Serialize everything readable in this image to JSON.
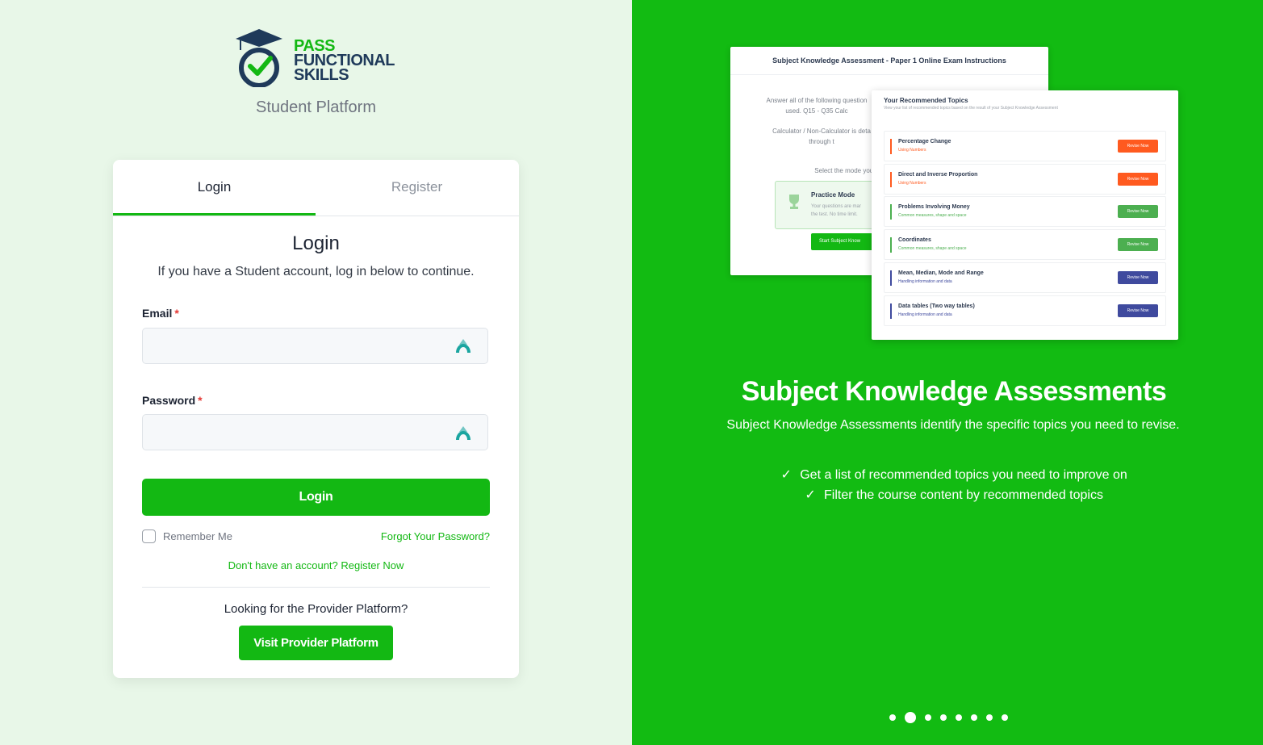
{
  "brand": {
    "logo_line1": "PASS",
    "logo_line2": "FUNCTIONAL",
    "logo_line3": "SKILLS",
    "platform": "Student Platform",
    "green": "#13b813",
    "navy": "#1f3a5a"
  },
  "tabs": [
    {
      "label": "Login",
      "active": true
    },
    {
      "label": "Register",
      "active": false
    }
  ],
  "login": {
    "title": "Login",
    "description": "If you have a Student account, log in below to continue.",
    "email_label": "Email",
    "email_value": "",
    "password_label": "Password",
    "password_value": "",
    "required_mark": "*",
    "submit_label": "Login",
    "remember_label": "Remember Me",
    "remember_checked": false,
    "forgot_label": "Forgot Your Password?",
    "register_prompt": "Don't have an account? Register Now",
    "provider_question": "Looking for the Provider Platform?",
    "provider_button": "Visit Provider Platform"
  },
  "preview": {
    "exam_title": "Subject Knowledge Assessment - Paper 1 Online Exam Instructions",
    "exam_text1a": "Answer all of the following question",
    "exam_text1b": "used. Q15 - Q35 Calc",
    "exam_text2a": "Calculator / Non-Calculator is deta",
    "exam_text2b": "through t",
    "exam_text3": "Select the mode you wo",
    "practice_title": "Practice Mode",
    "practice_desc_a": "Your questions are mar",
    "practice_desc_b": "the test. No time limit.",
    "start_button": "Start Subject Know",
    "topics_title": "Your Recommended Topics",
    "topics_subtitle": "View your list of recommended topics based on the result of your Subject Knowledge Assessment",
    "topics": [
      {
        "name": "Percentage Change",
        "category": "Using Numbers",
        "button": "Revise Now",
        "color": "#ff5a1f"
      },
      {
        "name": "Direct and Inverse Proportion",
        "category": "Using Numbers",
        "button": "Revise Now",
        "color": "#ff5a1f"
      },
      {
        "name": "Problems Involving Money",
        "category": "Common measures, shape and space",
        "button": "Revise Now",
        "color": "#4caf50"
      },
      {
        "name": "Coordinates",
        "category": "Common measures, shape and space",
        "button": "Revise Now",
        "color": "#4caf50"
      },
      {
        "name": "Mean, Median, Mode and Range",
        "category": "Handling information and data",
        "button": "Revise Now",
        "color": "#3f4a9e"
      },
      {
        "name": "Data tables (Two way tables)",
        "category": "Handling information and data",
        "button": "Revise Now",
        "color": "#3f4a9e"
      }
    ]
  },
  "feature": {
    "title": "Subject Knowledge Assessments",
    "description": "Subject Knowledge Assessments identify the specific topics you need to revise.",
    "points": [
      "Get a list of recommended topics you need to improve on",
      "Filter the course content by recommended topics"
    ],
    "slide_count": 8,
    "active_slide": 2
  }
}
